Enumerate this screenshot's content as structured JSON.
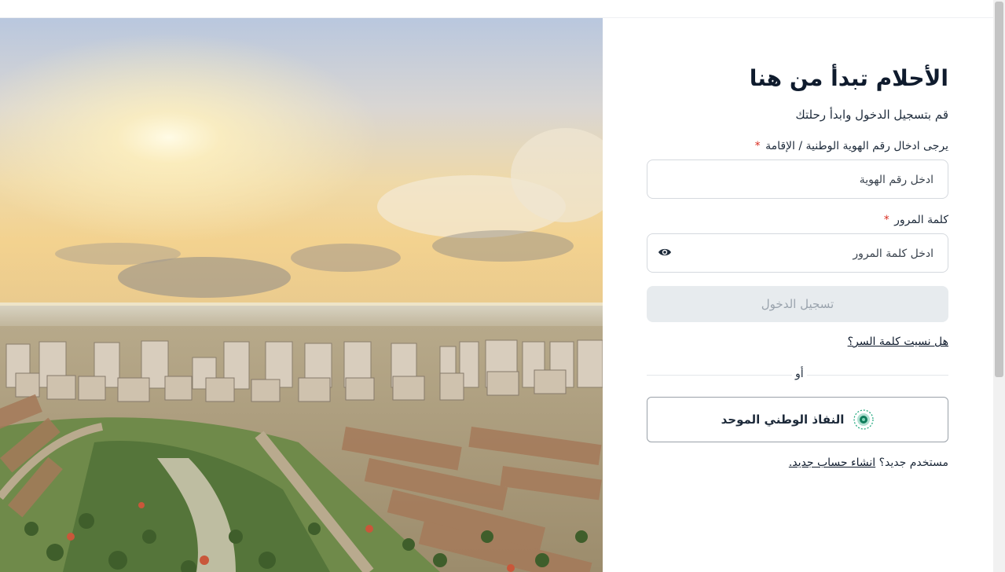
{
  "hero": {
    "image": "aerial rendering of residential city development at sunset"
  },
  "form": {
    "title": "الأحلام تبدأ من هنا",
    "subtitle": "قم بتسجيل الدخول وابدأ رحلتك",
    "id_label": "يرجى ادخال رقم الهوية الوطنية / الإقامة",
    "id_placeholder": "ادخل رقم الهوية",
    "id_value": "",
    "password_label": "كلمة المرور",
    "password_placeholder": "ادخل كلمة المرور",
    "password_value": "",
    "required_mark": "*",
    "eye_icon": "eye-icon",
    "login_button": "تسجيل الدخول",
    "forgot_password": "هل نسيت كلمة السر؟",
    "or": "أو",
    "nafath_label": "النفاذ الوطني الموحد",
    "nafath_icon": "nafath-logo-icon",
    "new_user_prefix": "مستخدم جديد؟",
    "create_account": "انشاء حساب جديد."
  },
  "colors": {
    "required": "#d92d20",
    "button_disabled_bg": "#e7ebee",
    "button_disabled_text": "#9aa3ad",
    "nafath_green": "#1aa57a"
  }
}
